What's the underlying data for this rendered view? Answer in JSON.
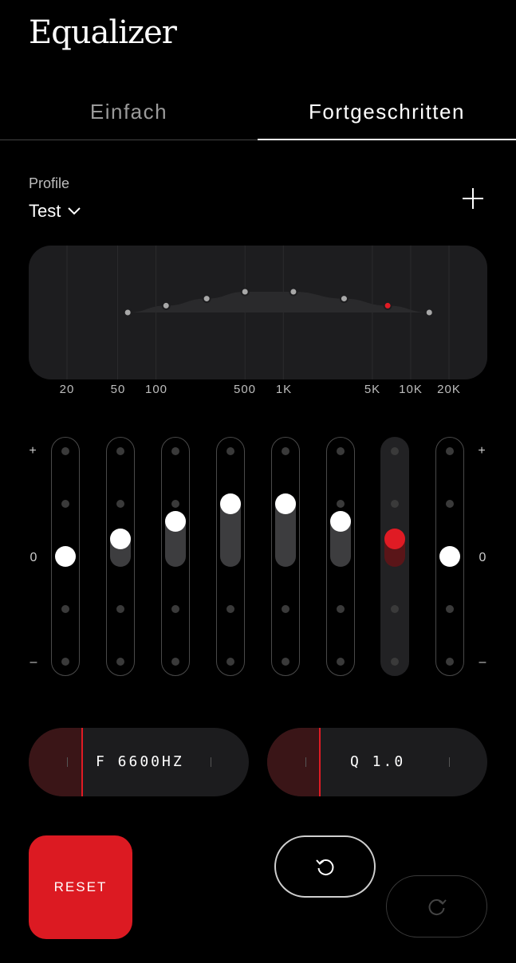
{
  "header": {
    "title": "Equalizer"
  },
  "tabs": [
    {
      "label": "Einfach",
      "active": false
    },
    {
      "label": "Fortgeschritten",
      "active": true
    }
  ],
  "profile": {
    "label": "Profile",
    "selected": "Test"
  },
  "graph": {
    "frequency_labels": [
      "20",
      "50",
      "100",
      "500",
      "1K",
      "5K",
      "10K",
      "20K"
    ],
    "bands_hz": [
      60,
      120,
      250,
      500,
      1200,
      3000,
      6600,
      14000
    ],
    "selected_band": 7
  },
  "gain_labels": {
    "plus": "+",
    "zero": "0",
    "minus": "–"
  },
  "sliders": {
    "gain_range": [
      -1,
      1
    ],
    "bands": [
      {
        "gain": 0.0,
        "active": false
      },
      {
        "gain": 0.33,
        "active": false
      },
      {
        "gain": 0.67,
        "active": false
      },
      {
        "gain": 1.0,
        "active": false
      },
      {
        "gain": 1.0,
        "active": false
      },
      {
        "gain": 0.67,
        "active": false
      },
      {
        "gain": 0.33,
        "active": true
      },
      {
        "gain": 0.0,
        "active": false
      }
    ]
  },
  "frequency_control": {
    "text": "F 6600HZ"
  },
  "q_control": {
    "text": "Q 1.0"
  },
  "actions": {
    "reset_label": "RESET"
  },
  "icons": {
    "profile_dropdown": "chevron-down-icon",
    "add_profile": "plus-icon",
    "undo": "undo-icon",
    "redo": "redo-icon"
  },
  "colors": {
    "accent": "#e01b24",
    "background": "#000000",
    "surface": "#1d1d1f"
  }
}
